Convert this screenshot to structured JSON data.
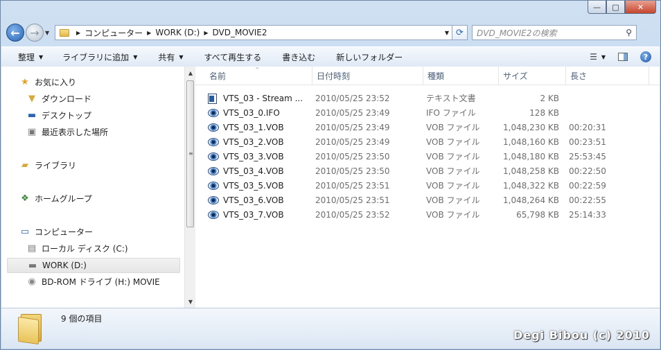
{
  "window": {
    "minimize_glyph": "—",
    "maximize_glyph": "□",
    "close_glyph": "✕"
  },
  "address_bar": {
    "crumbs": [
      "コンピューター",
      "WORK (D:)",
      "DVD_MOVIE2"
    ],
    "search_placeholder": "DVD_MOVIE2の検索"
  },
  "toolbar": {
    "organize": "整理",
    "add_to_library": "ライブラリに追加",
    "share": "共有",
    "play_all": "すべて再生する",
    "burn": "書き込む",
    "new_folder": "新しいフォルダー"
  },
  "nav_pane": {
    "favorites": "お気に入り",
    "downloads": "ダウンロード",
    "desktop": "デスクトップ",
    "recent": "最近表示した場所",
    "libraries": "ライブラリ",
    "homegroup": "ホームグループ",
    "computer": "コンピューター",
    "local_disk": "ローカル ディスク (C:)",
    "work_drive": "WORK (D:)",
    "bdrom": "BD-ROM ドライブ (H:) MOVIE"
  },
  "columns": {
    "name": "名前",
    "date": "日付時刻",
    "type": "種類",
    "size": "サイズ",
    "length": "長さ"
  },
  "files": [
    {
      "name": "VTS_03 - Stream ...",
      "date": "2010/05/25 23:52",
      "type": "テキスト文書",
      "size": "2 KB",
      "length": "",
      "icon": "text-document"
    },
    {
      "name": "VTS_03_0.IFO",
      "date": "2010/05/25 23:49",
      "type": "IFO ファイル",
      "size": "128 KB",
      "length": "",
      "icon": "media-eye"
    },
    {
      "name": "VTS_03_1.VOB",
      "date": "2010/05/25 23:49",
      "type": "VOB ファイル",
      "size": "1,048,230 KB",
      "length": "00:20:31",
      "icon": "media-eye"
    },
    {
      "name": "VTS_03_2.VOB",
      "date": "2010/05/25 23:49",
      "type": "VOB ファイル",
      "size": "1,048,160 KB",
      "length": "00:23:51",
      "icon": "media-eye"
    },
    {
      "name": "VTS_03_3.VOB",
      "date": "2010/05/25 23:50",
      "type": "VOB ファイル",
      "size": "1,048,180 KB",
      "length": "25:53:45",
      "icon": "media-eye"
    },
    {
      "name": "VTS_03_4.VOB",
      "date": "2010/05/25 23:50",
      "type": "VOB ファイル",
      "size": "1,048,258 KB",
      "length": "00:22:50",
      "icon": "media-eye"
    },
    {
      "name": "VTS_03_5.VOB",
      "date": "2010/05/25 23:51",
      "type": "VOB ファイル",
      "size": "1,048,322 KB",
      "length": "00:22:59",
      "icon": "media-eye"
    },
    {
      "name": "VTS_03_6.VOB",
      "date": "2010/05/25 23:51",
      "type": "VOB ファイル",
      "size": "1,048,264 KB",
      "length": "00:22:55",
      "icon": "media-eye"
    },
    {
      "name": "VTS_03_7.VOB",
      "date": "2010/05/25 23:52",
      "type": "VOB ファイル",
      "size": "65,798 KB",
      "length": "25:14:33",
      "icon": "media-eye"
    }
  ],
  "details": {
    "item_count": "9 個の項目"
  },
  "watermark": "Degi Bibou (c) 2010"
}
